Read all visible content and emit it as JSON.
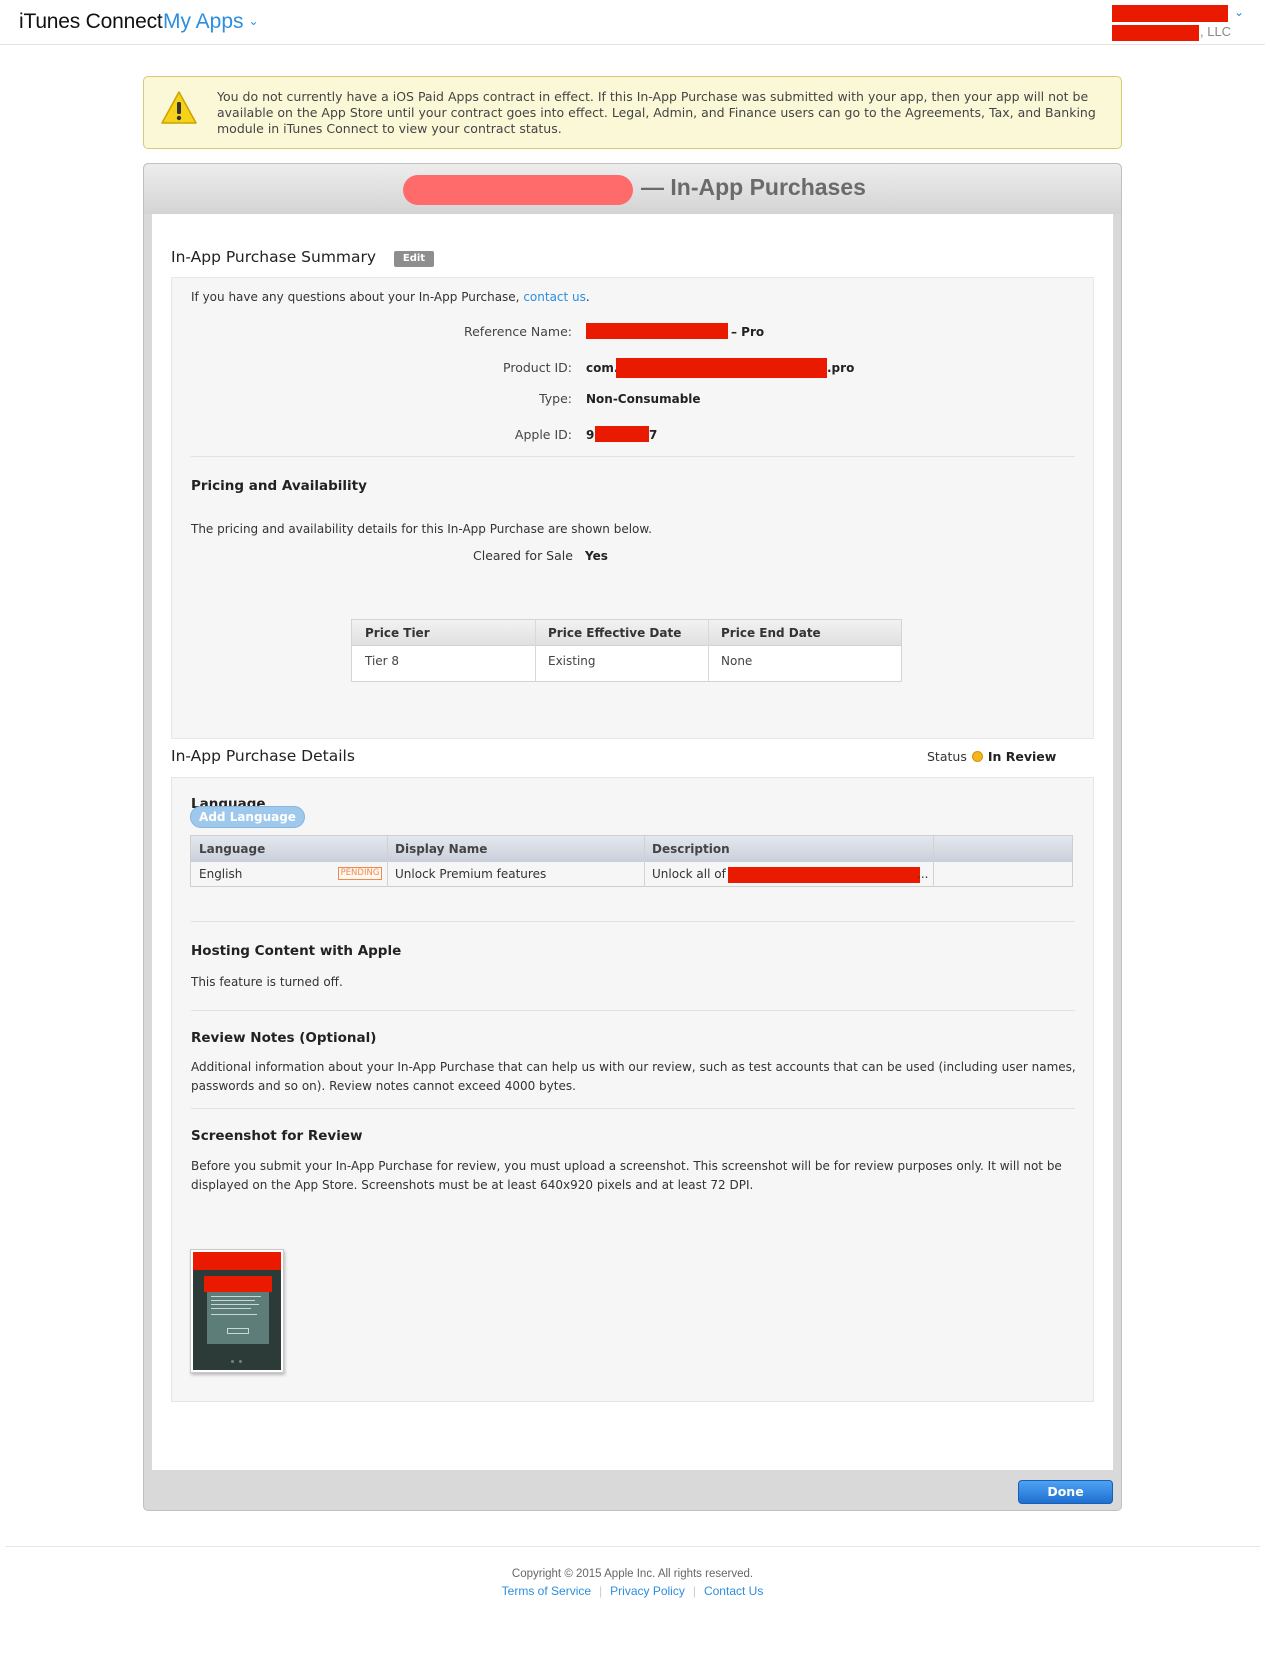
{
  "header": {
    "brand": "iTunes Connect",
    "nav_label": "My Apps",
    "account_suffix": ", LLC"
  },
  "warning": {
    "text": "You do not currently have a iOS Paid Apps contract in effect. If this In-App Purchase was submitted with your app, then your app will not be available on the App Store until your contract goes into effect. Legal, Admin, and Finance users can go to the Agreements, Tax, and Banking module in iTunes Connect to view your contract status."
  },
  "panel": {
    "title": "— In-App Purchases"
  },
  "summary": {
    "title": "In-App Purchase Summary",
    "edit_label": "Edit",
    "question_text": "If you have any questions about your In-App Purchase, ",
    "contact_link": "contact us",
    "question_end": ".",
    "fields": {
      "reference_name_label": "Reference Name:",
      "reference_name_suffix": "– Pro",
      "product_id_label": "Product ID:",
      "product_id_prefix": "com.",
      "product_id_suffix": ".pro",
      "type_label": "Type:",
      "type_value": "Non-Consumable",
      "apple_id_label": "Apple ID:",
      "apple_id_prefix": "9",
      "apple_id_suffix": "7"
    }
  },
  "pricing": {
    "title": "Pricing and Availability",
    "description": "The pricing and availability details for this In-App Purchase are shown below.",
    "cleared_label": "Cleared for Sale",
    "cleared_value": "Yes",
    "table": {
      "headers": [
        "Price Tier",
        "Price Effective Date",
        "Price End Date"
      ],
      "rows": [
        [
          "Tier 8",
          "Existing",
          "None"
        ]
      ]
    }
  },
  "details": {
    "title": "In-App Purchase Details",
    "status_label": "Status",
    "status_value": "In Review",
    "language": {
      "title": "Language",
      "add_button": "Add Language",
      "headers": [
        "Language",
        "Display Name",
        "Description"
      ],
      "rows": [
        {
          "language": "English",
          "badge": "PENDING",
          "display_name": "Unlock Premium features",
          "description_prefix": "Unlock all of",
          "description_suffix": "..."
        }
      ]
    },
    "hosting": {
      "title": "Hosting Content with Apple",
      "text": "This feature is turned off."
    },
    "review_notes": {
      "title": "Review Notes (Optional)",
      "text_line1": "Additional information about your In-App Purchase that can help us with our review, such as test accounts that can be used (including user names,",
      "text_line2": "passwords and so on). Review notes cannot exceed 4000 bytes."
    },
    "screenshot": {
      "title": "Screenshot for Review",
      "text_line1": "Before you submit your In-App Purchase for review, you must upload a screenshot. This screenshot will be for review purposes only. It will not be",
      "text_line2": "displayed on the App Store. Screenshots must be at least 640x920 pixels and at least 72 DPI."
    }
  },
  "done_label": "Done",
  "footer": {
    "copyright": "Copyright © 2015 Apple Inc. All rights reserved.",
    "links": [
      "Terms of Service",
      "Privacy Policy",
      "Contact Us"
    ]
  },
  "colors": {
    "accent_blue": "#2b8ee0",
    "redaction": "#ea1a00",
    "warning_bg": "#fbf8d8",
    "status_yellow": "#f5b51c",
    "pending_orange": "#f08a4b"
  },
  "icons": [
    "warning-icon",
    "chevron-down-icon",
    "status-dot-icon"
  ]
}
